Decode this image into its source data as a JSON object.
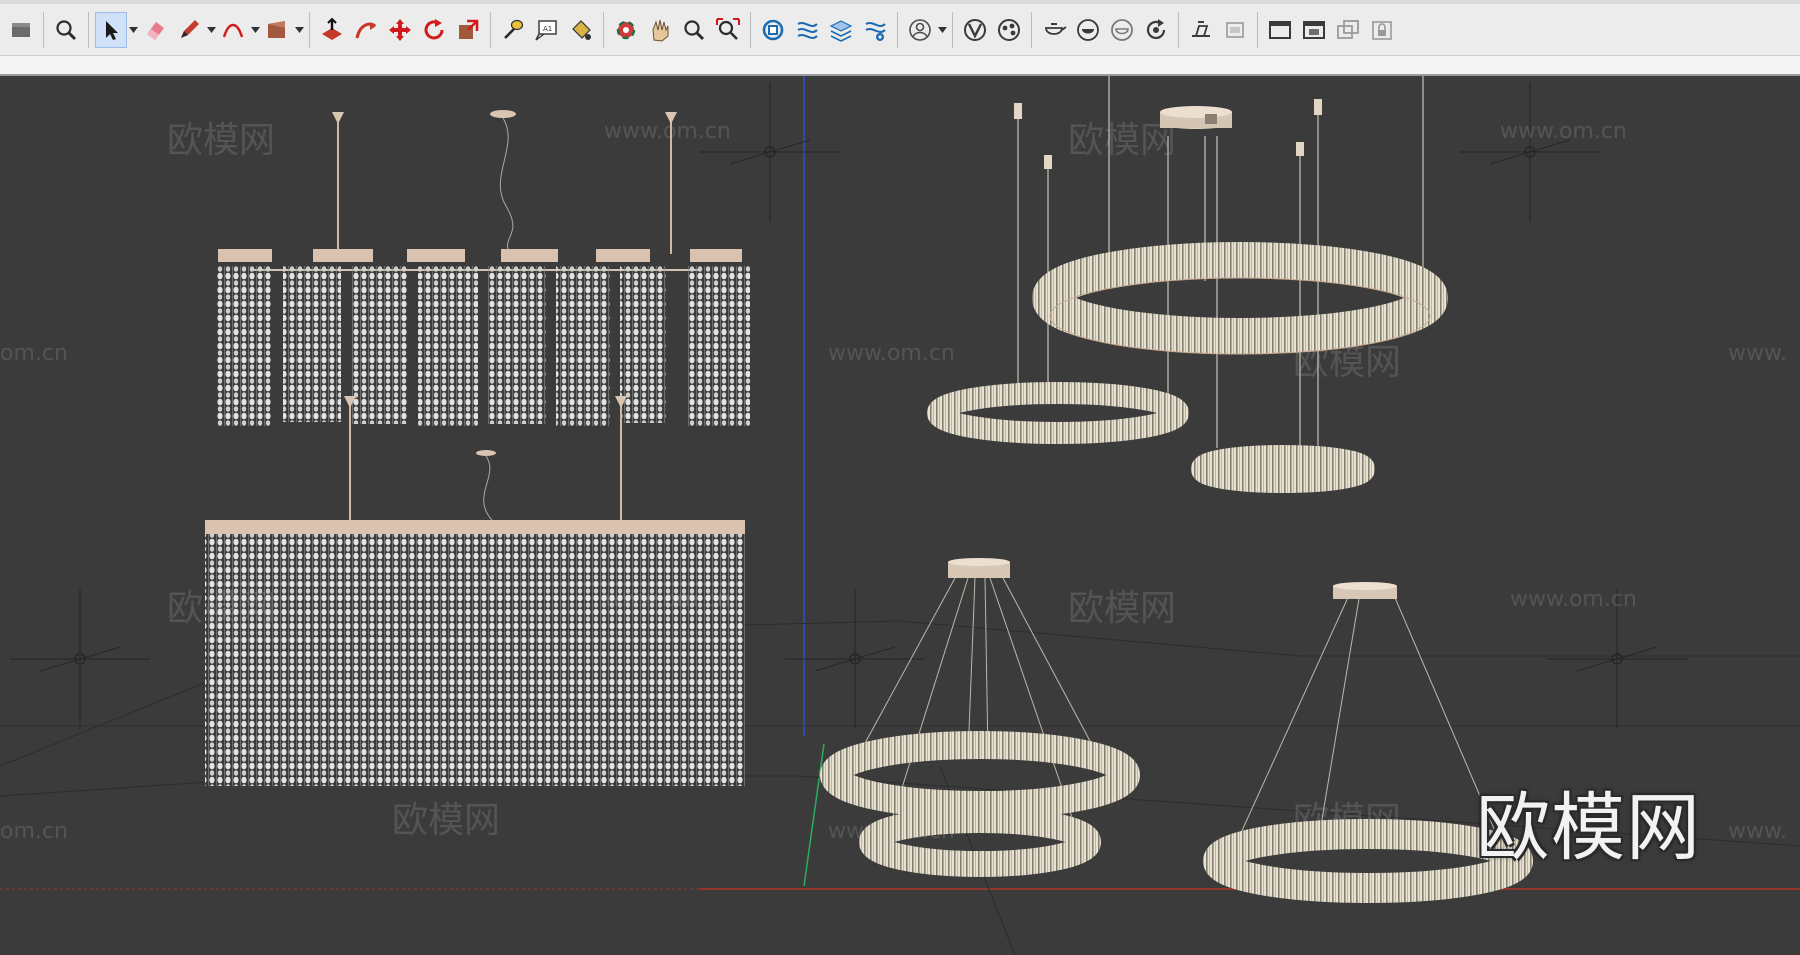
{
  "app": {
    "name": "SketchUp"
  },
  "toolbar": {
    "groups": [
      [
        "box-icon"
      ],
      [
        "zoom-icon"
      ],
      [
        "select-arrow-icon",
        "eraser-icon",
        "pencil-icon",
        "arc-icon",
        "shape-icon"
      ],
      [
        "push-pull-icon",
        "follow-me-icon",
        "move-icon",
        "rotate-icon",
        "scale-icon"
      ],
      [
        "tape-measure-icon",
        "text-icon",
        "paint-bucket-icon"
      ],
      [
        "orbit-icon",
        "pan-icon",
        "zoom-icon",
        "zoom-extents-icon"
      ],
      [
        "component-icon",
        "extension-icon",
        "layers-icon",
        "settings-icon"
      ],
      [
        "user-icon"
      ],
      [
        "vray-icon",
        "material-icon"
      ],
      [
        "teapot-icon",
        "teapot-render-icon",
        "teapot-interactive-icon",
        "refresh-render-icon"
      ],
      [
        "section-plane-icon",
        "section-fill-icon"
      ],
      [
        "window-icon",
        "window-render-icon",
        "window-compare-icon",
        "lock-icon"
      ]
    ]
  },
  "viewport": {
    "background_color": "#3b3b3b",
    "axis_colors": {
      "red": "#c0392b",
      "green": "#27ae60",
      "blue": "#2f4fc9"
    },
    "watermarks": [
      {
        "text": "欧模网",
        "kind": "big"
      },
      {
        "text": "www.om.cn",
        "kind": "url"
      },
      {
        "text": "欧模网",
        "kind": "big"
      },
      {
        "text": "www.om.cn",
        "kind": "url"
      },
      {
        "text": "om.cn",
        "kind": "url"
      },
      {
        "text": "www.om.cn",
        "kind": "url"
      },
      {
        "text": "欧模网",
        "kind": "big"
      },
      {
        "text": "www.",
        "kind": "url"
      },
      {
        "text": "欧模网",
        "kind": "big"
      },
      {
        "text": "www.om.cn",
        "kind": "url"
      },
      {
        "text": "欧模网",
        "kind": "big"
      },
      {
        "text": "www.om.cn",
        "kind": "url"
      },
      {
        "text": "om.cn",
        "kind": "url"
      },
      {
        "text": "欧模网",
        "kind": "big"
      },
      {
        "text": "www.om.cn",
        "kind": "url"
      },
      {
        "text": "欧模网",
        "kind": "big"
      },
      {
        "text": "www.",
        "kind": "url"
      }
    ],
    "models": [
      {
        "name": "linear-crystal-chandelier-strands",
        "kind": "linear"
      },
      {
        "name": "rectangular-crystal-curtain-chandelier",
        "kind": "curtain"
      },
      {
        "name": "three-ring-chandelier",
        "kind": "ring"
      },
      {
        "name": "two-ring-chandelier",
        "kind": "ring"
      },
      {
        "name": "single-ring-chandelier",
        "kind": "ring"
      }
    ],
    "brand_logo": {
      "text": "欧模网"
    }
  }
}
